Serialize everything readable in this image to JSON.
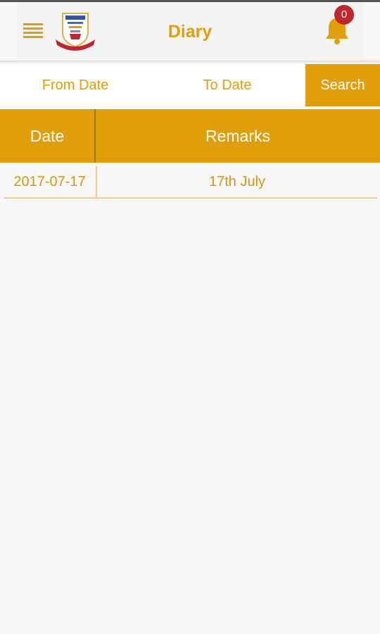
{
  "header": {
    "title": "Diary",
    "notification_count": "0"
  },
  "filters": {
    "from_date": "From Date",
    "to_date": "To Date",
    "search": "Search"
  },
  "table": {
    "columns": [
      "Date",
      "Remarks"
    ],
    "rows": [
      {
        "date": "2017-07-17",
        "remarks": "17th July"
      }
    ]
  },
  "colors": {
    "accent": "#e09e0a",
    "badge": "#c0262d",
    "background": "#f7f7f7"
  },
  "icons": {
    "menu": "hamburger-menu-icon",
    "logo": "school-crest-logo",
    "notification": "bell-icon"
  }
}
